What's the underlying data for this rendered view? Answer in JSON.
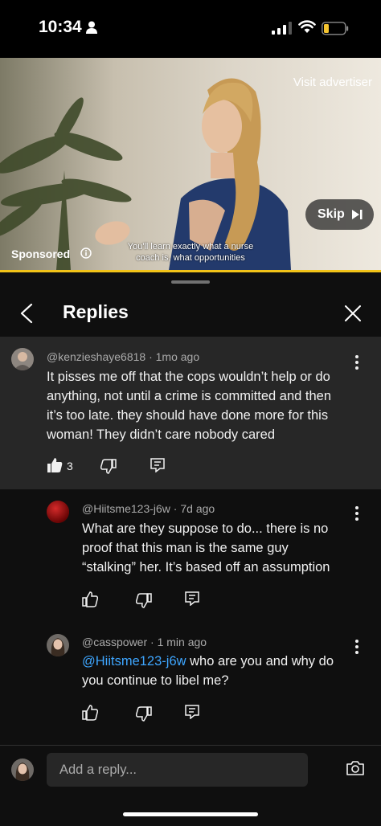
{
  "status": {
    "time": "10:34"
  },
  "ad": {
    "visit_label": "Visit advertiser",
    "skip_label": "Skip",
    "sponsored_label": "Sponsored",
    "caption_line1": "You'll learn exactly what a nurse",
    "caption_line2": "coach is, what opportunities",
    "accent": "#f2c318"
  },
  "header": {
    "title": "Replies"
  },
  "comment": {
    "author": "@kenzieshaye6818",
    "age": "1mo ago",
    "text_lines": [
      "It pisses me off that the cops wouldn’t help or do",
      "anything, not until a crime is committed and then",
      "it’s too late. they should have done more for this",
      "woman! They didn’t care nobody cared"
    ],
    "likes": "3"
  },
  "replies": [
    {
      "author": "@Hiitsme123-j6w",
      "age": "7d ago",
      "text_lines": [
        "What are they suppose to do... there is no",
        "proof that this man is the same guy",
        "“stalking” her. It’s based off an assumption"
      ]
    },
    {
      "author": "@casspower",
      "age": "1 min ago",
      "mention": "@Hiitsme123-j6w",
      "text_line1_rest": " who are you and why do",
      "text_line2": "you continue to libel me?"
    }
  ],
  "composer": {
    "placeholder": "Add a reply..."
  },
  "icons": [
    "person-icon",
    "signal-icon",
    "wifi-icon",
    "battery-icon",
    "info-icon",
    "skip-icon",
    "back-icon",
    "close-icon",
    "more-icon",
    "thumbs-up-icon",
    "thumbs-down-icon",
    "reply-icon",
    "camera-icon"
  ]
}
